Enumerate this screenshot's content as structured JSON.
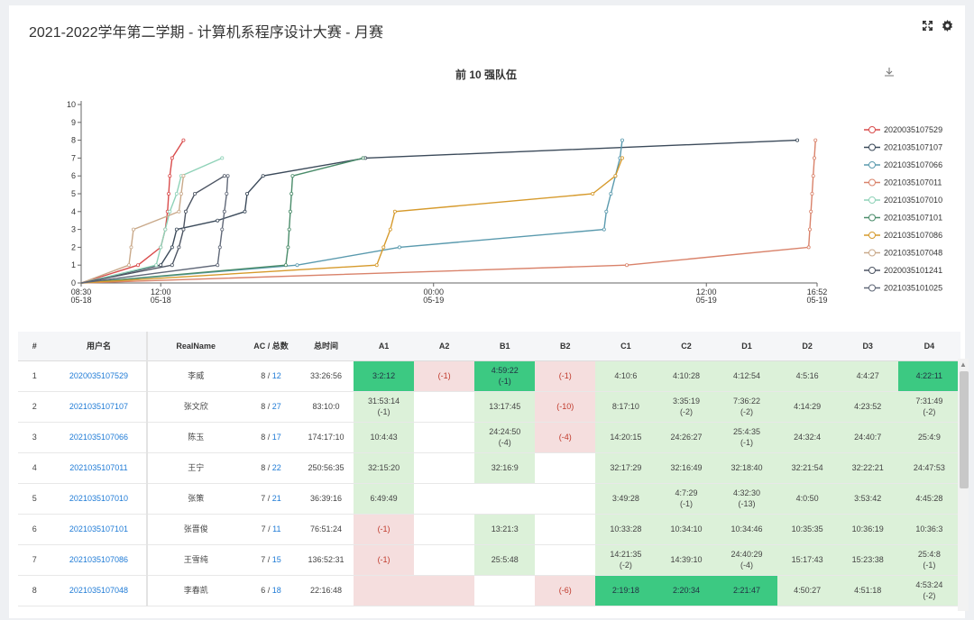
{
  "page": {
    "title": "2021-2022学年第二学期 - 计算机系程序设计大赛 - 月赛",
    "icons": [
      "fullscreen-icon",
      "settings-icon",
      "download-icon"
    ]
  },
  "chart_data": {
    "type": "line",
    "title": "前 10 强队伍",
    "ylim": [
      0,
      10
    ],
    "y_ticks": [
      "0",
      "1",
      "2",
      "3",
      "4",
      "5",
      "6",
      "7",
      "8",
      "9",
      "10"
    ],
    "x_ticks": [
      {
        "label1": "08:30",
        "label2": "05-18"
      },
      {
        "label1": "12:00",
        "label2": "05-18"
      },
      {
        "label1": "00:00",
        "label2": "05-19"
      },
      {
        "label1": "12:00",
        "label2": "05-19"
      },
      {
        "label1": "16:52",
        "label2": "05-19"
      }
    ],
    "x_unit": "hours since 05-18 08:30",
    "xlim": [
      0,
      32.37
    ],
    "legend_position": "right",
    "series": [
      {
        "name": "2020035107529",
        "color": "#d94c4c",
        "points": [
          [
            0,
            0
          ],
          [
            2.5,
            1
          ],
          [
            3.5,
            2
          ],
          [
            3.7,
            3
          ],
          [
            3.8,
            4
          ],
          [
            3.85,
            5
          ],
          [
            3.9,
            6
          ],
          [
            4.0,
            7
          ],
          [
            4.5,
            8
          ]
        ]
      },
      {
        "name": "2021035107107",
        "color": "#3b4a5a",
        "points": [
          [
            0,
            0
          ],
          [
            3.5,
            1
          ],
          [
            4.0,
            2
          ],
          [
            4.2,
            3
          ],
          [
            6.0,
            3.5
          ],
          [
            7.2,
            4
          ],
          [
            7.3,
            5
          ],
          [
            8.0,
            6
          ],
          [
            12.5,
            7
          ],
          [
            31.5,
            8
          ]
        ]
      },
      {
        "name": "2021035107066",
        "color": "#5a9aae",
        "points": [
          [
            0,
            0
          ],
          [
            9.5,
            1
          ],
          [
            14.0,
            2
          ],
          [
            23.0,
            3
          ],
          [
            23.1,
            4
          ],
          [
            23.3,
            5
          ],
          [
            23.5,
            6
          ],
          [
            23.7,
            7
          ],
          [
            23.8,
            8
          ]
        ]
      },
      {
        "name": "2021035107011",
        "color": "#d9826a",
        "points": [
          [
            0,
            0
          ],
          [
            24.0,
            1
          ],
          [
            32.0,
            2
          ],
          [
            32.05,
            3
          ],
          [
            32.1,
            4
          ],
          [
            32.15,
            5
          ],
          [
            32.2,
            6
          ],
          [
            32.25,
            7
          ],
          [
            32.3,
            8
          ]
        ]
      },
      {
        "name": "2021035107010",
        "color": "#8fd2b8",
        "points": [
          [
            0,
            0
          ],
          [
            3.3,
            1
          ],
          [
            3.5,
            2
          ],
          [
            3.7,
            3
          ],
          [
            3.9,
            4
          ],
          [
            4.2,
            5
          ],
          [
            4.4,
            6
          ],
          [
            6.2,
            7
          ]
        ]
      },
      {
        "name": "2021035107101",
        "color": "#4a8c6a",
        "points": [
          [
            0,
            0
          ],
          [
            9.0,
            1
          ],
          [
            9.1,
            2
          ],
          [
            9.15,
            3
          ],
          [
            9.2,
            4
          ],
          [
            9.25,
            5
          ],
          [
            9.3,
            6
          ],
          [
            12.4,
            7
          ]
        ]
      },
      {
        "name": "2021035107086",
        "color": "#d69a2c",
        "points": [
          [
            0,
            0
          ],
          [
            13.0,
            1
          ],
          [
            13.3,
            2
          ],
          [
            13.6,
            3
          ],
          [
            13.8,
            4
          ],
          [
            22.5,
            5
          ],
          [
            23.5,
            6
          ],
          [
            23.8,
            7
          ]
        ]
      },
      {
        "name": "2021035107048",
        "color": "#c9a98a",
        "points": [
          [
            0,
            0
          ],
          [
            2.1,
            1
          ],
          [
            2.2,
            2
          ],
          [
            2.3,
            3
          ],
          [
            4.3,
            4
          ],
          [
            4.4,
            5
          ],
          [
            4.5,
            6
          ]
        ]
      },
      {
        "name": "2020035101241",
        "color": "#4d5563",
        "points": [
          [
            0,
            0
          ],
          [
            4.0,
            1
          ],
          [
            4.3,
            2
          ],
          [
            4.5,
            3
          ],
          [
            4.6,
            4
          ],
          [
            5.0,
            5
          ],
          [
            6.3,
            6
          ]
        ]
      },
      {
        "name": "2021035101025",
        "color": "#606878",
        "points": [
          [
            0,
            0
          ],
          [
            6.0,
            1
          ],
          [
            6.1,
            2
          ],
          [
            6.2,
            3
          ],
          [
            6.3,
            4
          ],
          [
            6.4,
            5
          ],
          [
            6.45,
            6
          ]
        ]
      }
    ]
  },
  "table": {
    "headers": [
      "#",
      "用户名",
      "RealName",
      "AC / 总数",
      "总时间",
      "A1",
      "A2",
      "B1",
      "B2",
      "C1",
      "C2",
      "D1",
      "D2",
      "D3",
      "D4"
    ],
    "rows": [
      {
        "rank": "1",
        "user": "2020035107529",
        "name": "李威",
        "ac": "8",
        "total": "12",
        "time": "33:26:56",
        "cells": [
          [
            "first",
            "3:2:12",
            ""
          ],
          [
            "bad",
            "(-1)",
            ""
          ],
          [
            "first",
            "4:59:22",
            "(-1)"
          ],
          [
            "bad",
            "(-1)",
            ""
          ],
          [
            "ok",
            "4:10:6",
            ""
          ],
          [
            "ok",
            "4:10:28",
            ""
          ],
          [
            "ok",
            "4:12:54",
            ""
          ],
          [
            "ok",
            "4:5:16",
            ""
          ],
          [
            "ok",
            "4:4:27",
            ""
          ],
          [
            "first",
            "4:22:11",
            ""
          ]
        ]
      },
      {
        "rank": "2",
        "user": "2021035107107",
        "name": "张文欣",
        "ac": "8",
        "total": "27",
        "time": "83:10:0",
        "cells": [
          [
            "ok",
            "31:53:14",
            "(-1)"
          ],
          [
            "",
            "",
            ""
          ],
          [
            "ok",
            "13:17:45",
            ""
          ],
          [
            "bad",
            "(-10)",
            ""
          ],
          [
            "ok",
            "8:17:10",
            ""
          ],
          [
            "ok",
            "3:35:19",
            "(-2)"
          ],
          [
            "ok",
            "7:36:22",
            "(-2)"
          ],
          [
            "ok",
            "4:14:29",
            ""
          ],
          [
            "ok",
            "4:23:52",
            ""
          ],
          [
            "ok",
            "7:31:49",
            "(-2)"
          ]
        ]
      },
      {
        "rank": "3",
        "user": "2021035107066",
        "name": "陈玉",
        "ac": "8",
        "total": "17",
        "time": "174:17:10",
        "cells": [
          [
            "ok",
            "10:4:43",
            ""
          ],
          [
            "",
            "",
            ""
          ],
          [
            "ok",
            "24:24:50",
            "(-4)"
          ],
          [
            "bad",
            "(-4)",
            ""
          ],
          [
            "ok",
            "14:20:15",
            ""
          ],
          [
            "ok",
            "24:26:27",
            ""
          ],
          [
            "ok",
            "25:4:35",
            "(-1)"
          ],
          [
            "ok",
            "24:32:4",
            ""
          ],
          [
            "ok",
            "24:40:7",
            ""
          ],
          [
            "ok",
            "25:4:9",
            ""
          ]
        ]
      },
      {
        "rank": "4",
        "user": "2021035107011",
        "name": "王宁",
        "ac": "8",
        "total": "22",
        "time": "250:56:35",
        "cells": [
          [
            "ok",
            "32:15:20",
            ""
          ],
          [
            "",
            "",
            ""
          ],
          [
            "ok",
            "32:16:9",
            ""
          ],
          [
            "",
            "",
            ""
          ],
          [
            "ok",
            "32:17:29",
            ""
          ],
          [
            "ok",
            "32:16:49",
            ""
          ],
          [
            "ok",
            "32:18:40",
            ""
          ],
          [
            "ok",
            "32:21:54",
            ""
          ],
          [
            "ok",
            "32:22:21",
            ""
          ],
          [
            "ok",
            "24:47:53",
            ""
          ]
        ]
      },
      {
        "rank": "5",
        "user": "2021035107010",
        "name": "张策",
        "ac": "7",
        "total": "21",
        "time": "36:39:16",
        "cells": [
          [
            "ok",
            "6:49:49",
            ""
          ],
          [
            "",
            "",
            ""
          ],
          [
            "",
            "",
            ""
          ],
          [
            "",
            "",
            ""
          ],
          [
            "ok",
            "3:49:28",
            ""
          ],
          [
            "ok",
            "4:7:29",
            "(-1)"
          ],
          [
            "ok",
            "4:32:30",
            "(-13)"
          ],
          [
            "ok",
            "4:0:50",
            ""
          ],
          [
            "ok",
            "3:53:42",
            ""
          ],
          [
            "ok",
            "4:45:28",
            ""
          ]
        ]
      },
      {
        "rank": "6",
        "user": "2021035107101",
        "name": "张晋俊",
        "ac": "7",
        "total": "11",
        "time": "76:51:24",
        "cells": [
          [
            "bad",
            "(-1)",
            ""
          ],
          [
            "",
            "",
            ""
          ],
          [
            "ok",
            "13:21:3",
            ""
          ],
          [
            "",
            "",
            ""
          ],
          [
            "ok",
            "10:33:28",
            ""
          ],
          [
            "ok",
            "10:34:10",
            ""
          ],
          [
            "ok",
            "10:34:46",
            ""
          ],
          [
            "ok",
            "10:35:35",
            ""
          ],
          [
            "ok",
            "10:36:19",
            ""
          ],
          [
            "ok",
            "10:36:3",
            ""
          ]
        ]
      },
      {
        "rank": "7",
        "user": "2021035107086",
        "name": "王雪纯",
        "ac": "7",
        "total": "15",
        "time": "136:52:31",
        "cells": [
          [
            "bad",
            "(-1)",
            ""
          ],
          [
            "",
            "",
            ""
          ],
          [
            "ok",
            "25:5:48",
            ""
          ],
          [
            "",
            "",
            ""
          ],
          [
            "ok",
            "14:21:35",
            "(-2)"
          ],
          [
            "ok",
            "14:39:10",
            ""
          ],
          [
            "ok",
            "24:40:29",
            "(-4)"
          ],
          [
            "ok",
            "15:17:43",
            ""
          ],
          [
            "ok",
            "15:23:38",
            ""
          ],
          [
            "ok",
            "25:4:8",
            "(-1)"
          ]
        ]
      },
      {
        "rank": "8",
        "user": "2021035107048",
        "name": "李春凯",
        "ac": "6",
        "total": "18",
        "time": "22:16:48",
        "cells": [
          [
            "bad",
            "",
            ""
          ],
          [
            "bad",
            "",
            ""
          ],
          [
            "",
            "",
            ""
          ],
          [
            "bad",
            "(-6)",
            ""
          ],
          [
            "first",
            "2:19:18",
            ""
          ],
          [
            "first",
            "2:20:34",
            ""
          ],
          [
            "first",
            "2:21:47",
            ""
          ],
          [
            "ok",
            "4:50:27",
            ""
          ],
          [
            "ok",
            "4:51:18",
            ""
          ],
          [
            "ok",
            "4:53:24",
            "(-2)"
          ]
        ]
      }
    ]
  }
}
